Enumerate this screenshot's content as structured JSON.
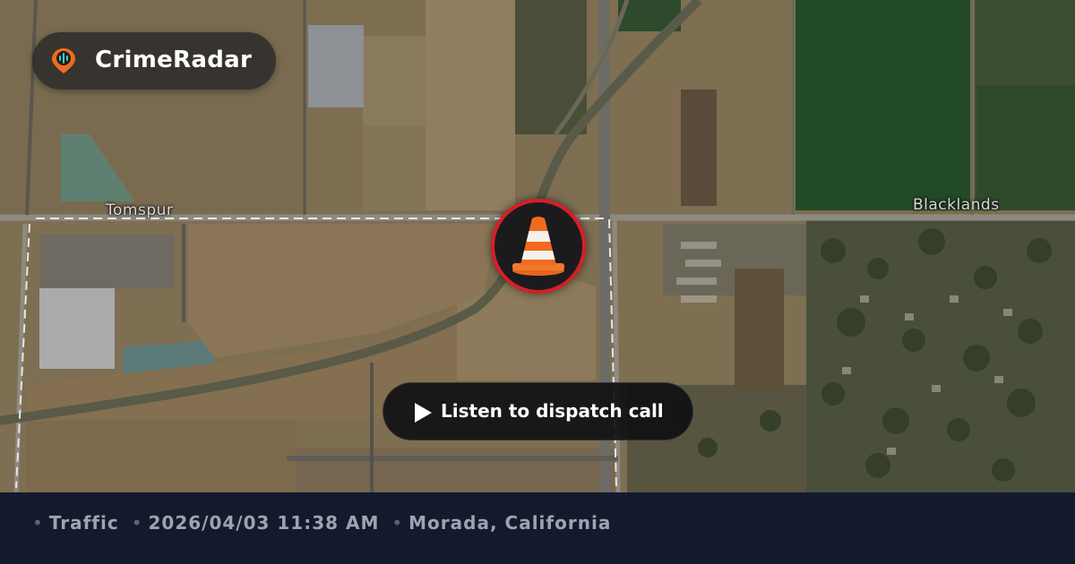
{
  "brand": {
    "name": "CrimeRadar",
    "logo_icon": "radar-pin-icon",
    "logo_color": "#f26b1d"
  },
  "map": {
    "place_labels": [
      "Tomspur",
      "Blacklands"
    ],
    "marker_icon": "traffic-cone-icon",
    "marker_ring_color": "#d61f26"
  },
  "cta": {
    "label": "Listen to dispatch call",
    "icon": "play-icon"
  },
  "incident": {
    "category": "Traffic",
    "datetime": "2026/04/03 11:38 AM",
    "location": "Morada, California"
  },
  "colors": {
    "footer_bg": "#141a2e",
    "footer_text": "#9ea3b0"
  }
}
